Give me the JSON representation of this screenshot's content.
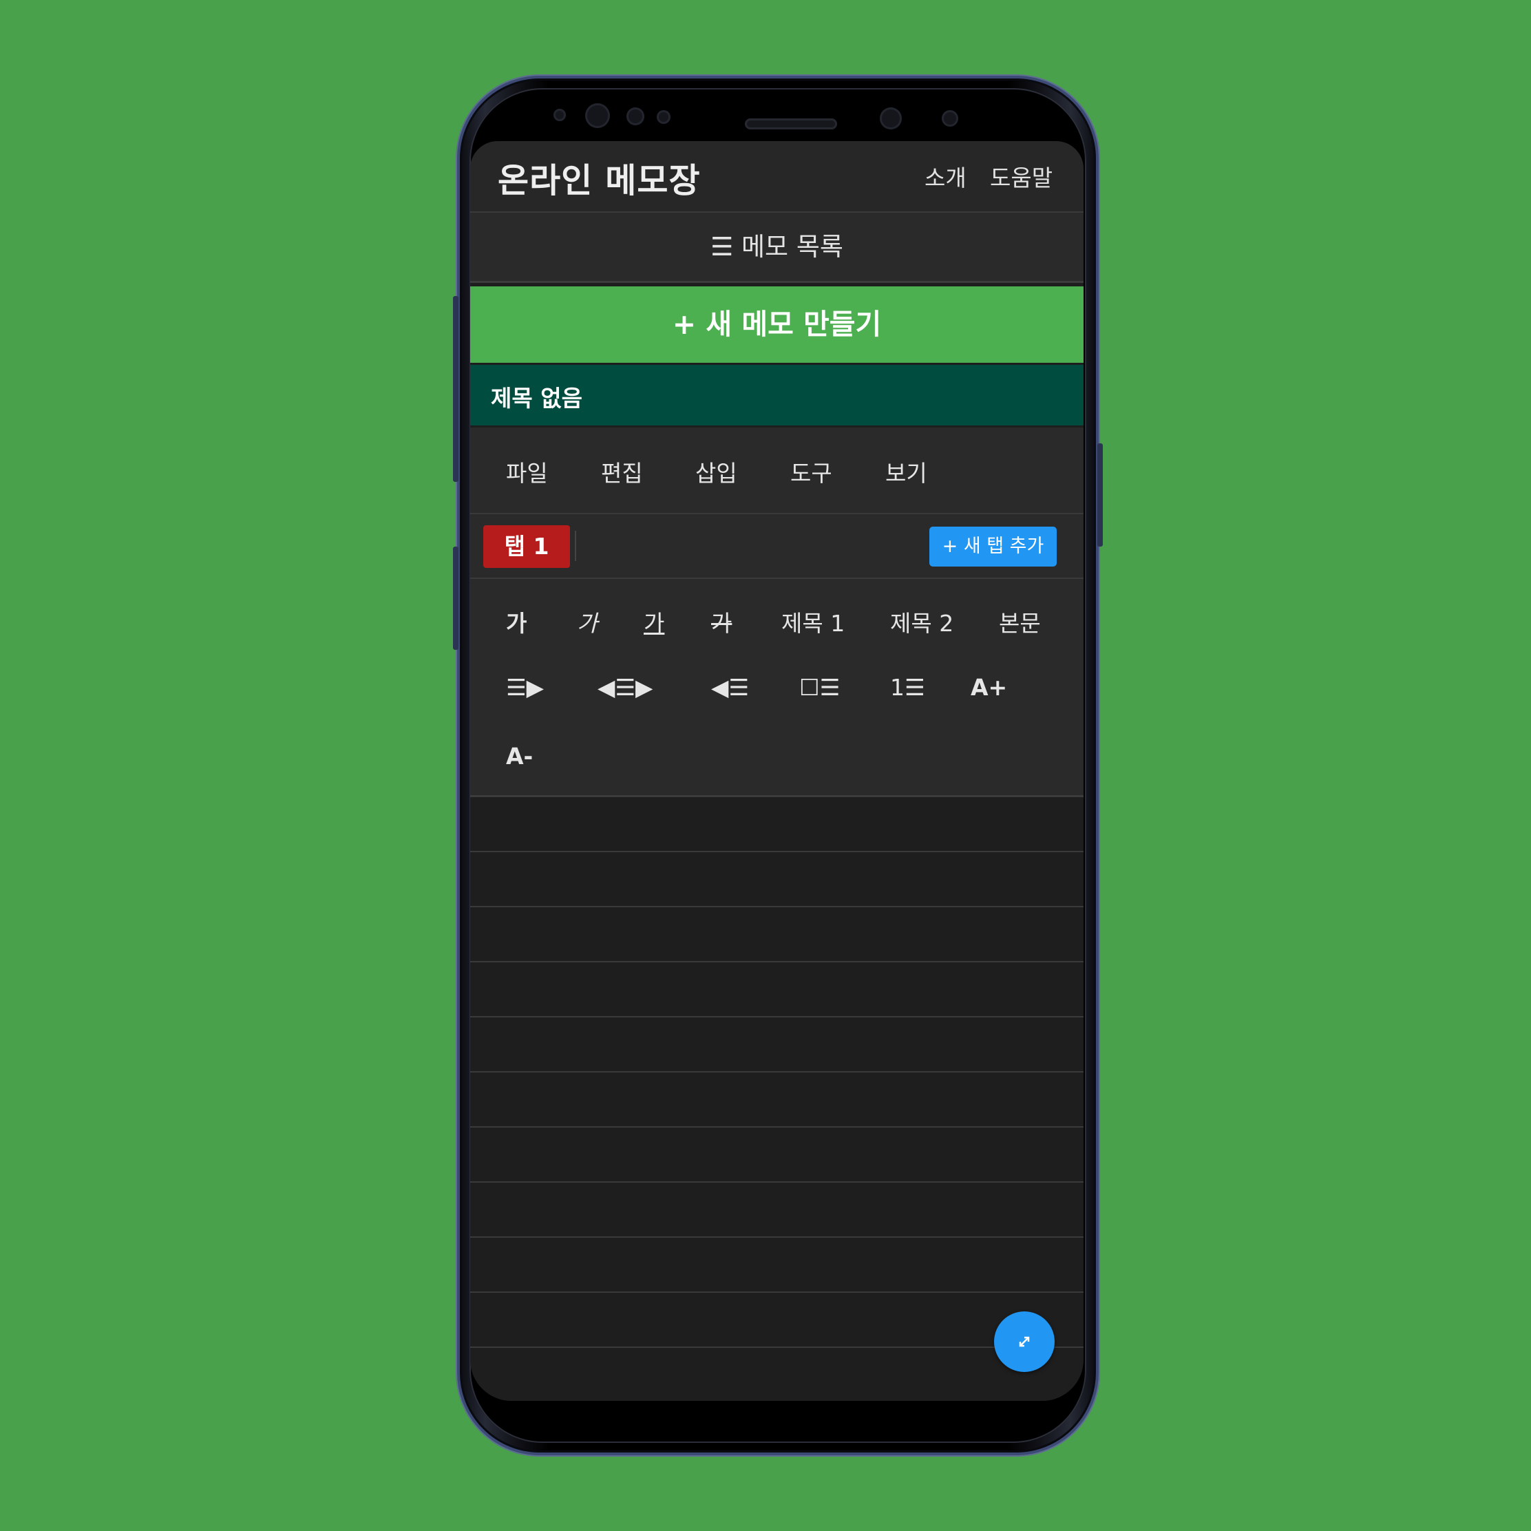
{
  "colors": {
    "background": "#4aa14c",
    "header": "#272727",
    "new_memo": "#4caf50",
    "memo_item": "#004d40",
    "tab_active": "#b71c1c",
    "accent_blue": "#2196f3",
    "editor_bg": "#1e1e1e"
  },
  "header": {
    "title": "온라인 메모장",
    "links": [
      "소개",
      "도움말"
    ]
  },
  "memo_list": {
    "label": "☰ 메모 목록"
  },
  "new_memo_button": "+ 새 메모 만들기",
  "memos": [
    {
      "title": "제목 없음"
    }
  ],
  "menu": [
    "파일",
    "편집",
    "삽입",
    "도구",
    "보기"
  ],
  "tabs": {
    "items": [
      "탭 1"
    ],
    "add_label": "+ 새 탭 추가"
  },
  "format_toolbar": {
    "bold": "가",
    "italic": "가",
    "underline": "가",
    "strike": "가",
    "heading1": "제목 1",
    "heading2": "제목 2",
    "body": "본문",
    "indent": "☰▶",
    "center": "◀☰▶",
    "outdent": "◀☰",
    "checklist": "☐☰",
    "numbered": "1☰",
    "font_up": "A+",
    "font_down": "A-"
  },
  "fab": {
    "icon": "expand-arrows-icon"
  }
}
